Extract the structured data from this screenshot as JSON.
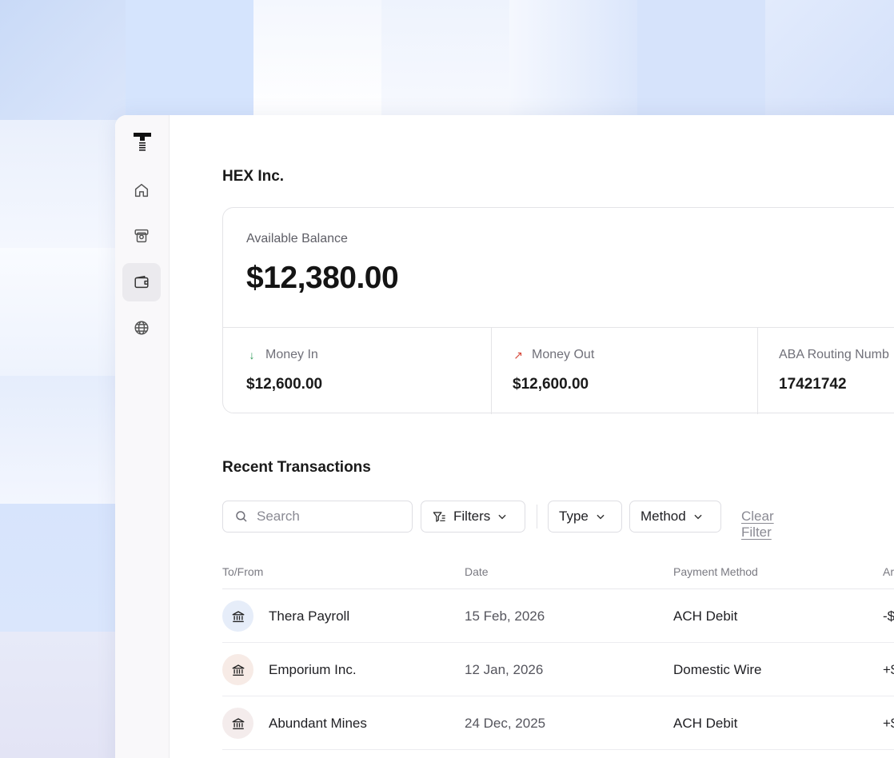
{
  "company": "HEX Inc.",
  "balance": {
    "label": "Available Balance",
    "value": "$12,380.00"
  },
  "stats": [
    {
      "label": "Money In",
      "value": "$12,600.00",
      "arrow": "↓",
      "color": "#2e9a57"
    },
    {
      "label": "Money Out",
      "value": "$12,600.00",
      "arrow": "↗",
      "color": "#d6493b"
    },
    {
      "label": "ABA Routing Numb",
      "value": "17421742"
    }
  ],
  "nav": [
    {
      "icon": "home-icon"
    },
    {
      "icon": "atm-icon"
    },
    {
      "icon": "wallet-icon",
      "active": true
    },
    {
      "icon": "globe-icon"
    }
  ],
  "transactions_section": {
    "title": "Recent Transactions",
    "search_placeholder": "Search",
    "filters_label": "Filters",
    "type_label": "Type",
    "method_label": "Method",
    "clear_label": "Clear Filter"
  },
  "table": {
    "headers": {
      "to_from": "To/From",
      "date": "Date",
      "method": "Payment Method",
      "amount": "Ar"
    },
    "rows": [
      {
        "name": "Thera Payroll",
        "date": "15 Feb, 2026",
        "method": "ACH Debit",
        "amount": "-$",
        "avatar_bg": "#e6edf9"
      },
      {
        "name": "Emporium Inc.",
        "date": "12 Jan, 2026",
        "method": "Domestic Wire",
        "amount": "+$",
        "avatar_bg": "#f7ebe6"
      },
      {
        "name": "Abundant Mines",
        "date": "24 Dec, 2025",
        "method": "ACH Debit",
        "amount": "+$",
        "avatar_bg": "#f4ecec"
      }
    ]
  }
}
